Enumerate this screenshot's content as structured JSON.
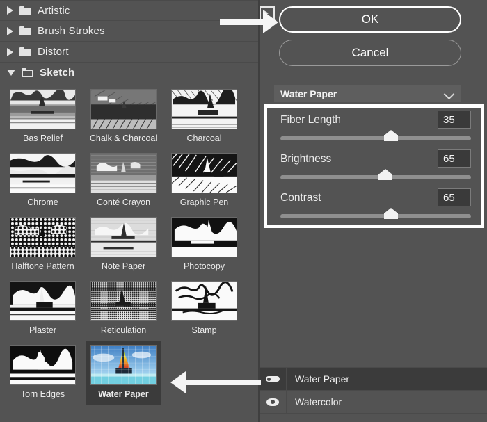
{
  "categories": [
    {
      "label": "Artistic",
      "expanded": false
    },
    {
      "label": "Brush Strokes",
      "expanded": false
    },
    {
      "label": "Distort",
      "expanded": false
    },
    {
      "label": "Sketch",
      "expanded": true
    }
  ],
  "thumbnails": [
    {
      "label": "Bas Relief",
      "selected": false
    },
    {
      "label": "Chalk & Charcoal",
      "selected": false
    },
    {
      "label": "Charcoal",
      "selected": false
    },
    {
      "label": "Chrome",
      "selected": false
    },
    {
      "label": "Conté Crayon",
      "selected": false
    },
    {
      "label": "Graphic Pen",
      "selected": false
    },
    {
      "label": "Halftone Pattern",
      "selected": false
    },
    {
      "label": "Note Paper",
      "selected": false
    },
    {
      "label": "Photocopy",
      "selected": false
    },
    {
      "label": "Plaster",
      "selected": false
    },
    {
      "label": "Reticulation",
      "selected": false
    },
    {
      "label": "Stamp",
      "selected": false
    },
    {
      "label": "Torn Edges",
      "selected": false
    },
    {
      "label": "Water Paper",
      "selected": true
    }
  ],
  "buttons": {
    "ok_label": "OK",
    "cancel_label": "Cancel"
  },
  "filter_select": {
    "value": "Water Paper"
  },
  "sliders": [
    {
      "name": "Fiber Length",
      "value": "35",
      "percent": 58
    },
    {
      "name": "Brightness",
      "value": "65",
      "percent": 55
    },
    {
      "name": "Contrast",
      "value": "65",
      "percent": 58
    }
  ],
  "filter_stack": [
    {
      "label": "Water Paper",
      "selected": true,
      "eye": "eye-open-flat-icon"
    },
    {
      "label": "Watercolor",
      "selected": false,
      "eye": "eye-open-icon"
    }
  ],
  "colors": {
    "panel_bg": "#535353",
    "selected_bg": "#3b3b3b",
    "accent_white": "#ffffff",
    "text": "#ececec"
  }
}
